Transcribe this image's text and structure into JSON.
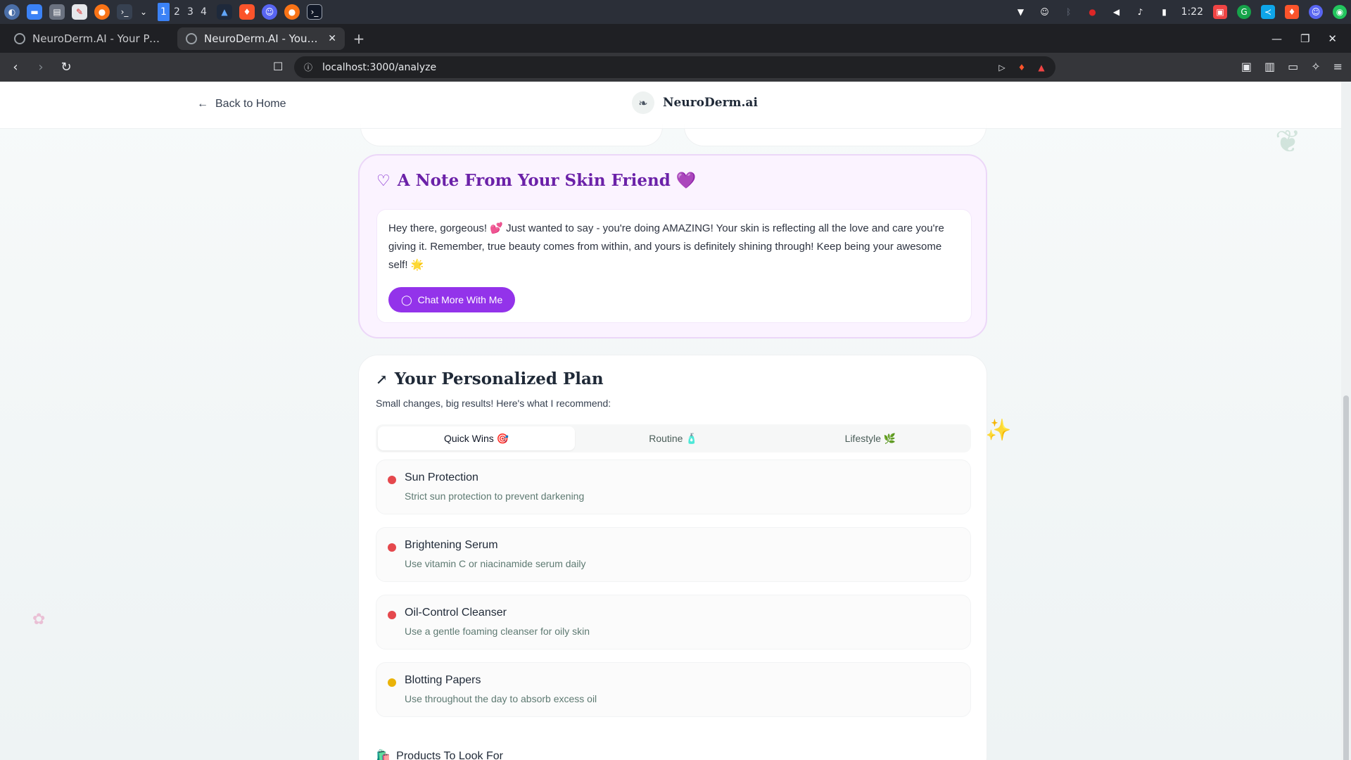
{
  "taskbar": {
    "workspaces": [
      "1",
      "2",
      "3",
      "4"
    ],
    "active_workspace": "1",
    "clock": "1:22"
  },
  "browser": {
    "tabs": [
      {
        "title": "NeuroDerm.AI - Your Peacefu",
        "active": false
      },
      {
        "title": "NeuroDerm.AI - Your Peac",
        "active": true
      }
    ],
    "url": "localhost:3000/analyze"
  },
  "header": {
    "back_label": "Back to Home",
    "brand_name": "NeuroDerm.ai"
  },
  "note": {
    "title": "A Note From Your Skin Friend 💜",
    "message": "Hey there, gorgeous! 💕 Just wanted to say - you're doing AMAZING! Your skin is reflecting all the love and care you're giving it. Remember, true beauty comes from within, and yours is definitely shining through! Keep being your awesome self! 🌟",
    "button_label": "Chat More With Me"
  },
  "plan": {
    "title": "Your Personalized Plan",
    "subtitle": "Small changes, big results! Here's what I recommend:",
    "tabs": [
      {
        "label": "Quick Wins 🎯",
        "active": true
      },
      {
        "label": "Routine 🧴",
        "active": false
      },
      {
        "label": "Lifestyle 🌿",
        "active": false
      }
    ],
    "items": [
      {
        "title": "Sun Protection",
        "desc": "Strict sun protection to prevent darkening",
        "color": "#e5484d"
      },
      {
        "title": "Brightening Serum",
        "desc": "Use vitamin C or niacinamide serum daily",
        "color": "#e5484d"
      },
      {
        "title": "Oil-Control Cleanser",
        "desc": "Use a gentle foaming cleanser for oily skin",
        "color": "#e5484d"
      },
      {
        "title": "Blotting Papers",
        "desc": "Use throughout the day to absorb excess oil",
        "color": "#eab308"
      }
    ],
    "products_heading": "Products To Look For"
  },
  "colors": {
    "accent_purple": "#9333ea",
    "note_title": "#6b21a8",
    "high_priority": "#e5484d",
    "medium_priority": "#eab308"
  }
}
